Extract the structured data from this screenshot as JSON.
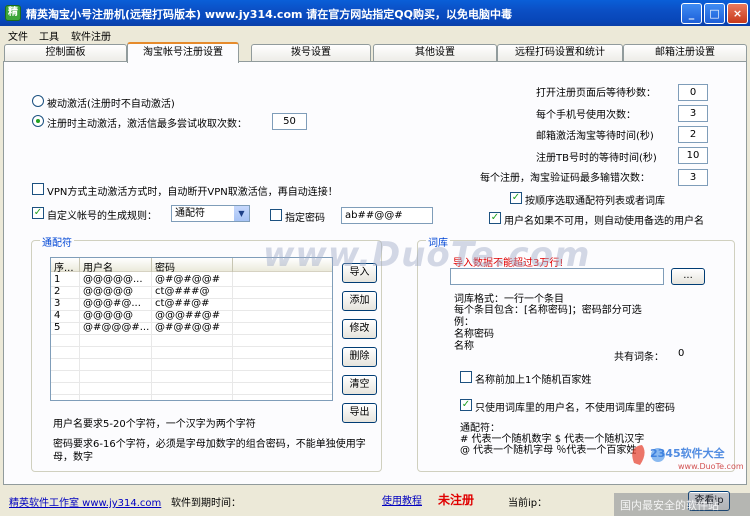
{
  "window": {
    "icon_glyph": "精",
    "title": "精英淘宝小号注册机(远程打码版本)    www.jy314.com    请在官方网站指定QQ购买，以免电脑中毒",
    "min": "_",
    "max": "□",
    "close": "×"
  },
  "menu": [
    "文件",
    "工具",
    "软件注册"
  ],
  "tabs": [
    "控制面板",
    "淘宝帐号注册设置",
    "拨号设置",
    "其他设置",
    "远程打码设置和统计",
    "邮箱注册设置"
  ],
  "left": {
    "radio_passive": "被动激活(注册时不自动激活)",
    "radio_active": "注册时主动激活，激活信最多尝试收取次数：",
    "active_tries": "50",
    "vpn_check": "VPN方式主动激活方式时，自动断开VPN取激活信，再自动连接！",
    "custom_rule_check": "自定义帐号的生成规则：",
    "rule_select": "通配符",
    "fixed_pwd_check": "指定密码",
    "fixed_pwd_value": "ab##@@#"
  },
  "right": {
    "wait_open_label": "打开注册页面后等待秒数：",
    "wait_open": "0",
    "phone_uses_label": "每个手机号使用次数：",
    "phone_uses": "3",
    "mail_wait_label": "邮箱激活淘宝等待时间(秒)",
    "mail_wait": "2",
    "tb_wait_label": "注册TB号时的等待时间(秒)",
    "tb_wait": "10",
    "captcha_err_label": "每个注册，淘宝验证码最多输错次数：",
    "captcha_err": "3",
    "seq_check": "按顺序选取通配符列表或者词库",
    "fallback_check": "用户名如果不可用，则自动使用备选的用户名"
  },
  "wildcard": {
    "legend": "通配符",
    "columns": [
      "序...",
      "用户名",
      "密码"
    ],
    "rows": [
      [
        "1",
        "@@@@@...",
        "@#@#@@#"
      ],
      [
        "2",
        "@@@@@",
        "ct@###@"
      ],
      [
        "3",
        "@@@#@...",
        "ct@##@#"
      ],
      [
        "4",
        "@@@@@",
        "@@@##@#"
      ],
      [
        "5",
        "@#@@@#...",
        "@#@#@@#"
      ]
    ],
    "buttons": [
      "导入",
      "添加",
      "修改",
      "删除",
      "清空",
      "导出"
    ],
    "note1": "用户名要求5-20个字符，一个汉字为两个字符",
    "note2a": "密码要求6-16个字符，必须是字母加数字的组合密码，不能单独使用字",
    "note2b": "母，数字"
  },
  "lexicon": {
    "legend": "词库",
    "import_warn": "导入数据不能超过3万行!",
    "browse": "...",
    "fmt1": "词库格式：一行一个条目",
    "fmt2": "每个条目包含：[名称密码]；密码部分可选",
    "fmt3": "例：",
    "fmt4": "名称密码",
    "fmt5": "名称",
    "total_label": "共有词条：",
    "total": "0",
    "surname_check": "名称前加上1个随机百家姓",
    "only_user_check": "只使用词库里的用户名，不使用词库里的密码",
    "wild_title": "通配符：",
    "wild1": "# 代表一个随机数字    $ 代表一个随机汉字",
    "wild2": "@ 代表一个随机字母    ％代表一个百家姓"
  },
  "status": {
    "studio": "精英软件工作室 www.jy314.com",
    "expire_label": "软件到期时间：",
    "tutorial": "使用教程",
    "unregistered": "未注册",
    "ip_label": "当前ip：",
    "view_btn": "查看ip"
  },
  "watermark": {
    "center": "www.DuoTe.com",
    "brand": "2345软件大全",
    "brand_url": "www.DuoTe.com",
    "slogan": "国内最安全的软件站"
  },
  "colors": {
    "accent": "#0046d5",
    "warn": "#e00000",
    "tab_highlight": "#e68b2c"
  }
}
